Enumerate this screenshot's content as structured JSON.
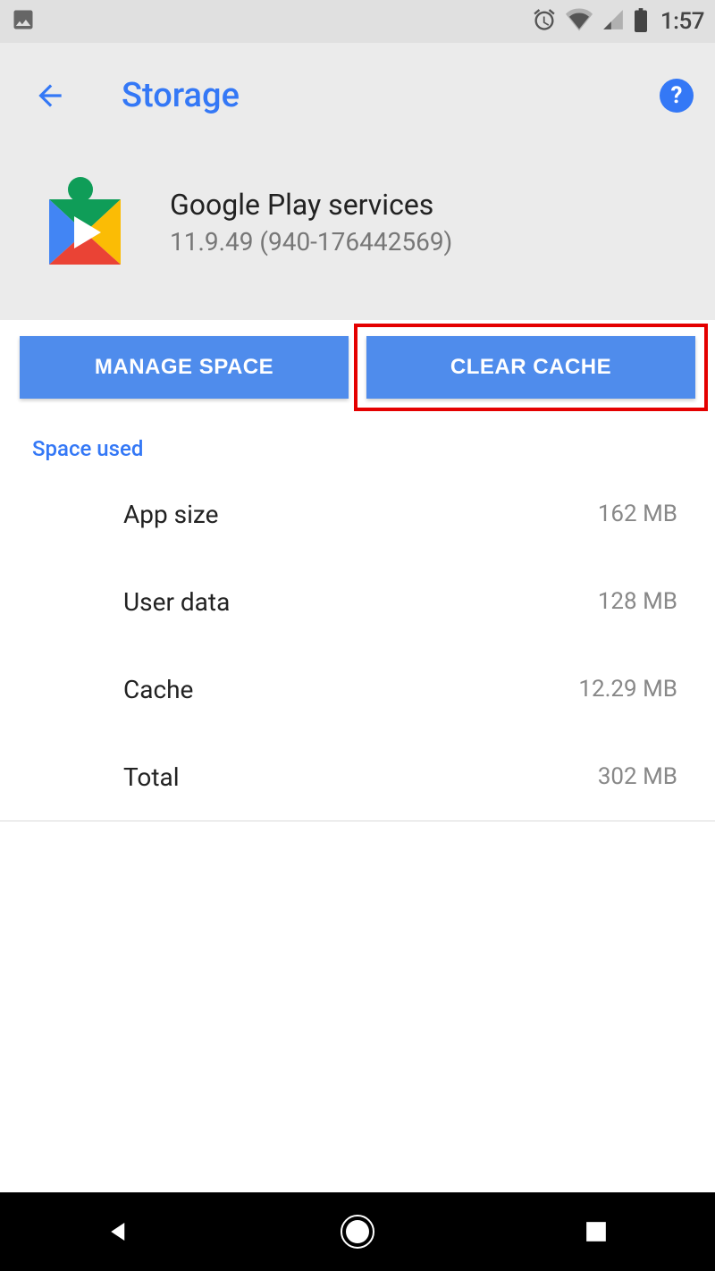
{
  "status_bar": {
    "time": "1:57"
  },
  "header": {
    "title": "Storage"
  },
  "app": {
    "name": "Google Play services",
    "version": "11.9.49 (940-176442569)"
  },
  "buttons": {
    "manage_space": "MANAGE SPACE",
    "clear_cache": "CLEAR CACHE"
  },
  "section": {
    "space_used": "Space used"
  },
  "storage": {
    "rows": [
      {
        "label": "App size",
        "value": "162 MB"
      },
      {
        "label": "User data",
        "value": "128 MB"
      },
      {
        "label": "Cache",
        "value": "12.29 MB"
      },
      {
        "label": "Total",
        "value": "302 MB"
      }
    ]
  }
}
